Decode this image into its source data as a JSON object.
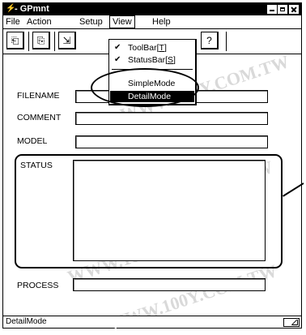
{
  "window": {
    "title": "GPmnt",
    "title_prefix": "- "
  },
  "menu": {
    "items": [
      "File",
      "Action",
      "Setup",
      "View",
      "Help"
    ],
    "active": "View"
  },
  "toolbar": {
    "icons": [
      "open-icon",
      "copy-icon",
      "transfer-icon",
      "print-icon",
      "help-icon"
    ]
  },
  "view_menu": {
    "items": [
      {
        "label": "ToolBar",
        "mnemonic": "T",
        "checked": true
      },
      {
        "label": "StatusBar",
        "mnemonic": "S",
        "checked": true
      },
      {
        "label": "SimpleMode",
        "checked": false
      },
      {
        "label": "DetailMode",
        "checked": false,
        "selected": true
      }
    ]
  },
  "form": {
    "filename_label": "FILENAME",
    "comment_label": "COMMENT",
    "model_label": "MODEL",
    "status_label": "STATUS",
    "process_label": "PROCESS",
    "filename_value": "",
    "comment_value": "",
    "model_value": "",
    "status_value": "",
    "process_value": ""
  },
  "statusbar": {
    "text": "DetailMode"
  },
  "watermark_text": "WWW.100Y.COM.TW",
  "colors": {
    "selection_bg": "#000000",
    "background": "#ffffff"
  }
}
